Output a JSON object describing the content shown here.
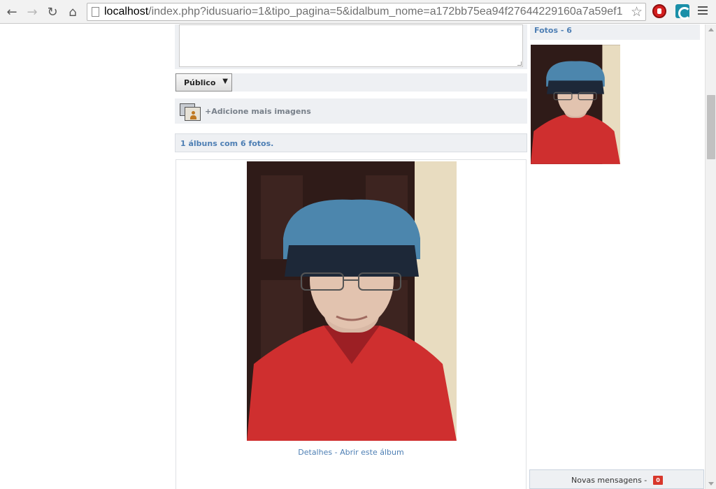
{
  "browser": {
    "url_host": "localhost",
    "url_rest": "/index.php?idusuario=1&tipo_pagina=5&idalbum_nome=a172bb75ea94f27644229160a7a59ef1",
    "icons": [
      "back-arrow-icon",
      "forward-arrow-icon",
      "reload-icon",
      "home-icon",
      "bookmark-star-icon",
      "stop-extension-icon",
      "extension-icon",
      "menu-icon"
    ]
  },
  "composer": {
    "privacy_value": "Público",
    "add_images_label": "+Adicione mais imagens"
  },
  "albums": {
    "summary": "1 álbuns com 6 fotos.",
    "details_link": "Detalhes",
    "separator": " - ",
    "open_album_link": "Abrir este álbum"
  },
  "sidebar": {
    "photos_header": "Fotos - 6"
  },
  "messages": {
    "label": "Novas mensagens - ",
    "count": "0"
  },
  "colors": {
    "link_blue": "#4e7fb4",
    "panel_gray": "#eef0f3",
    "badge_red": "#d8372b"
  }
}
